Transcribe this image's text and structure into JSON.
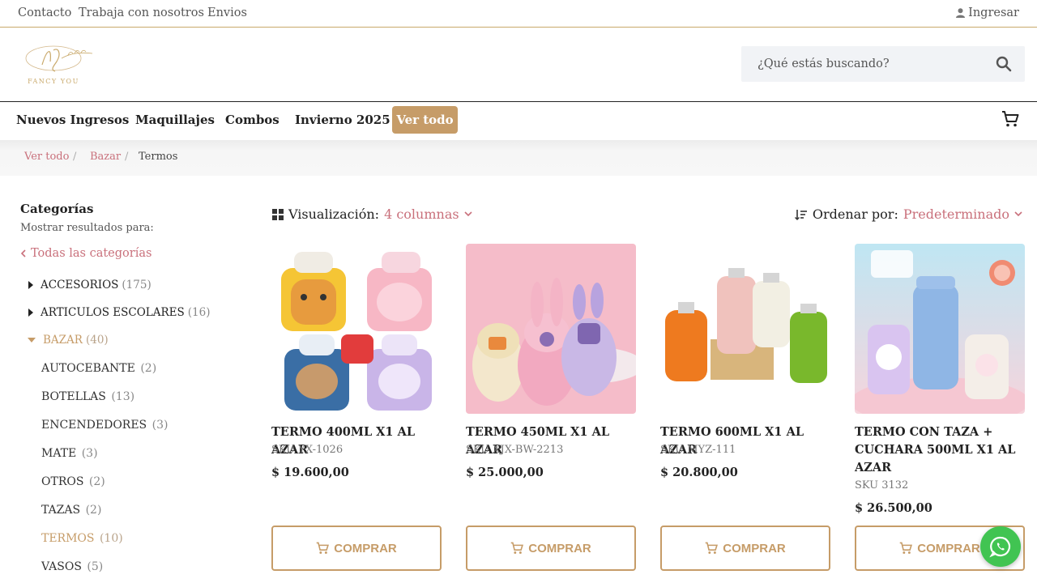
{
  "topbar": {
    "links": [
      "Contacto",
      "Trabaja con nosotros",
      "Envios"
    ],
    "login": "Ingresar"
  },
  "header": {
    "logo_text": "FANCY YOU",
    "search_placeholder": "¿Qué estás buscando?"
  },
  "nav": {
    "items": [
      "Nuevos Ingresos",
      "Maquillajes",
      "Combos",
      "Invierno 2025"
    ],
    "view_all": "Ver todo"
  },
  "breadcrumb": [
    "Ver todo",
    "Bazar",
    "Termos"
  ],
  "sidebar": {
    "title": "Categorías",
    "subtitle": "Mostrar resultados para:",
    "all_categories": "Todas las categorías",
    "categories": [
      {
        "name": "ACCESORIOS",
        "count": "(175)"
      },
      {
        "name": "ARTICULOS ESCOLARES",
        "count": "(16)"
      },
      {
        "name": "BAZAR",
        "count": "(40)"
      }
    ],
    "subcategories": [
      {
        "name": "AUTOCEBANTE",
        "count": "(2)"
      },
      {
        "name": "BOTELLAS",
        "count": "(13)"
      },
      {
        "name": "ENCENDEDORES",
        "count": "(3)"
      },
      {
        "name": "MATE",
        "count": "(3)"
      },
      {
        "name": "OTROS",
        "count": "(2)"
      },
      {
        "name": "TAZAS",
        "count": "(2)"
      },
      {
        "name": "TERMOS",
        "count": "(10)"
      },
      {
        "name": "VASOS",
        "count": "(5)"
      }
    ]
  },
  "toolbar": {
    "view_label": "Visualización:",
    "view_value": "4 columnas",
    "sort_label": "Ordenar por:",
    "sort_value": "Predeterminado"
  },
  "products": [
    {
      "name": "TERMO 400ML X1 AL AZAR",
      "sku": "SKU YX-1026",
      "price": "$  19.600,00"
    },
    {
      "name": "TERMO 450ML X1 AL AZAR",
      "sku": "SKU XJX-BW-2213",
      "price": "$  25.000,00"
    },
    {
      "name": "TERMO 600ML X1 AL AZAR",
      "sku": "SKU MYZ-111",
      "price": "$  20.800,00"
    },
    {
      "name": "TERMO CON TAZA + CUCHARA 500ML X1 AL AZAR",
      "sku": "SKU 3132",
      "price": "$  26.500,00"
    }
  ],
  "buy_label": "COMPRAR",
  "colors": {
    "accent": "#c69c68",
    "link": "#c9707b",
    "whatsapp": "#41c452"
  }
}
